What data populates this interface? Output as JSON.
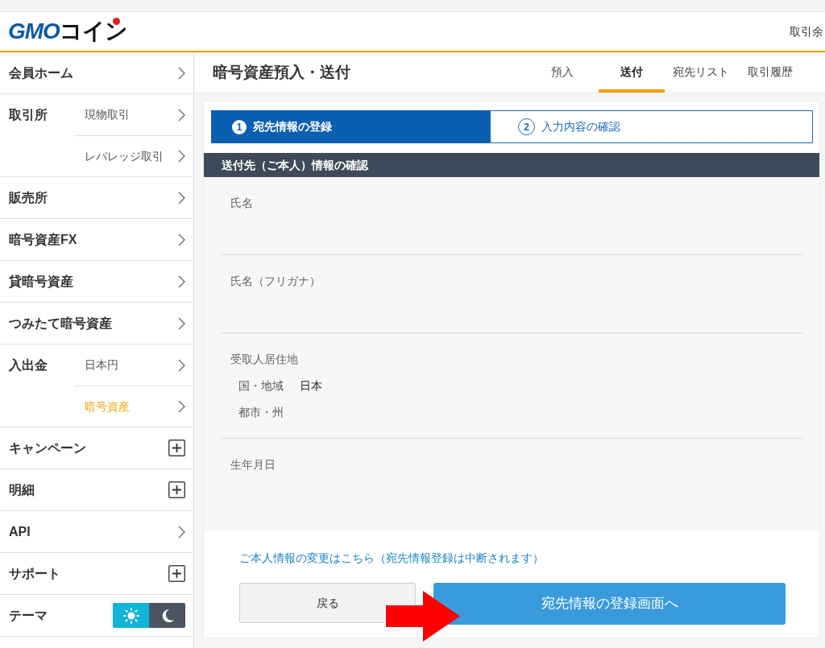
{
  "header": {
    "logo": {
      "latin": "GMO",
      "kana": "コイン"
    },
    "account_label": "取引余"
  },
  "sidebar": {
    "items": [
      {
        "label": "会員ホーム",
        "kind": "link"
      },
      {
        "label": "取引所",
        "kind": "group",
        "children": [
          {
            "label": "現物取引",
            "selected": false
          },
          {
            "label": "レバレッジ取引",
            "selected": false
          }
        ]
      },
      {
        "label": "販売所",
        "kind": "link"
      },
      {
        "label": "暗号資産FX",
        "kind": "link"
      },
      {
        "label": "貸暗号資産",
        "kind": "link"
      },
      {
        "label": "つみたて暗号資産",
        "kind": "link"
      },
      {
        "label": "入出金",
        "kind": "group",
        "children": [
          {
            "label": "日本円",
            "selected": false
          },
          {
            "label": "暗号資産",
            "selected": true
          }
        ]
      },
      {
        "label": "キャンペーン",
        "kind": "expand"
      },
      {
        "label": "明細",
        "kind": "expand"
      },
      {
        "label": "API",
        "kind": "link"
      },
      {
        "label": "サポート",
        "kind": "expand"
      },
      {
        "label": "テーマ",
        "kind": "theme",
        "options": [
          {
            "kind": "sun",
            "selected": true
          },
          {
            "kind": "moon",
            "selected": false
          }
        ]
      }
    ]
  },
  "main": {
    "title": "暗号資産預入・送付",
    "tabs": [
      {
        "label": "預入",
        "selected": false
      },
      {
        "label": "送付",
        "selected": true
      },
      {
        "label": "宛先リスト",
        "selected": false
      },
      {
        "label": "取引履歴",
        "selected": false
      }
    ],
    "steps": [
      {
        "number": "1",
        "label": "宛先情報の登録",
        "selected": true
      },
      {
        "number": "2",
        "label": "入力内容の確認",
        "selected": false
      }
    ],
    "section_title": "送付先（ご本人）情報の確認",
    "fields": [
      {
        "label": "氏名"
      },
      {
        "label": "氏名（フリガナ）"
      },
      {
        "label": "受取人居住地",
        "rows": [
          {
            "label": "国・地域",
            "value": "日本"
          },
          {
            "label": "都市・州"
          }
        ]
      },
      {
        "label": "生年月日"
      }
    ],
    "change_link": "ご本人情報の変更はこちら（宛先情報登録は中断されます）",
    "buttons": [
      {
        "label": "戻る",
        "kind": "secondary"
      },
      {
        "label": "宛先情報の登録画面へ",
        "kind": "primary"
      }
    ]
  }
}
